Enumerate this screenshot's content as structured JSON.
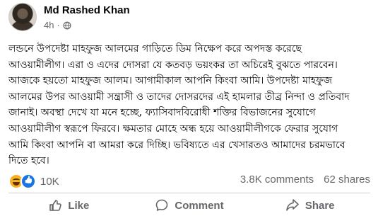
{
  "post": {
    "author": "Md Rashed Khan",
    "time": "4h",
    "separator": "·",
    "lines": [
      "লন্ডনে উপদেষ্টা মাহফুজ আলমের গাড়িতে ডিম নিক্ষেপ করে অপদস্ত করেছে",
      "আওয়ামীলীগ। এরা ও এদের দোসরা  যে কতবড় ভয়ংকর তা অচিরেই বুঝতে পারবেন।",
      "আজকে হয়তো মাহফুজ আলম। আগামীকাল আপনি কিংবা আমি।      উপদেষ্টা মাহফুজ",
      "আলমের উপর আওয়ামী সন্ত্রাসী ও তাদের দোসরদের এই হামলার তীব্র নিন্দা ও প্রতিবাদ",
      "জানাই। অবস্থা দেখে যা মনে হচ্ছে, ফ্যাসিবাদবিরোধী শক্তির বিভাজনের সুযোগে",
      "আওয়ামীলীগ স্বরূপে ফিরবে। ক্ষমতার মোহে অন্ধ হয়ে আওয়ামীলীগকে ফেরার সুযোগ",
      "আমি কিংবা আপনি বা আমরা করে দিচ্ছি। ভবিষ্যতে এর খেসারতও আমাদের চরমভাবে",
      "দিতে হবে।"
    ]
  },
  "stats": {
    "reactions_count": "10K",
    "comments": "3.8K comments",
    "shares": "62 shares"
  },
  "actions": {
    "like": "Like",
    "comment": "Comment",
    "share": "Share"
  },
  "icons": {
    "privacy": "globe-icon",
    "reactions": [
      "haha-reaction-icon",
      "like-reaction-icon"
    ]
  },
  "colors": {
    "meta_text": "#65676b",
    "like_blue": "#1b74e4",
    "haha_yellow": "#f7b125"
  }
}
